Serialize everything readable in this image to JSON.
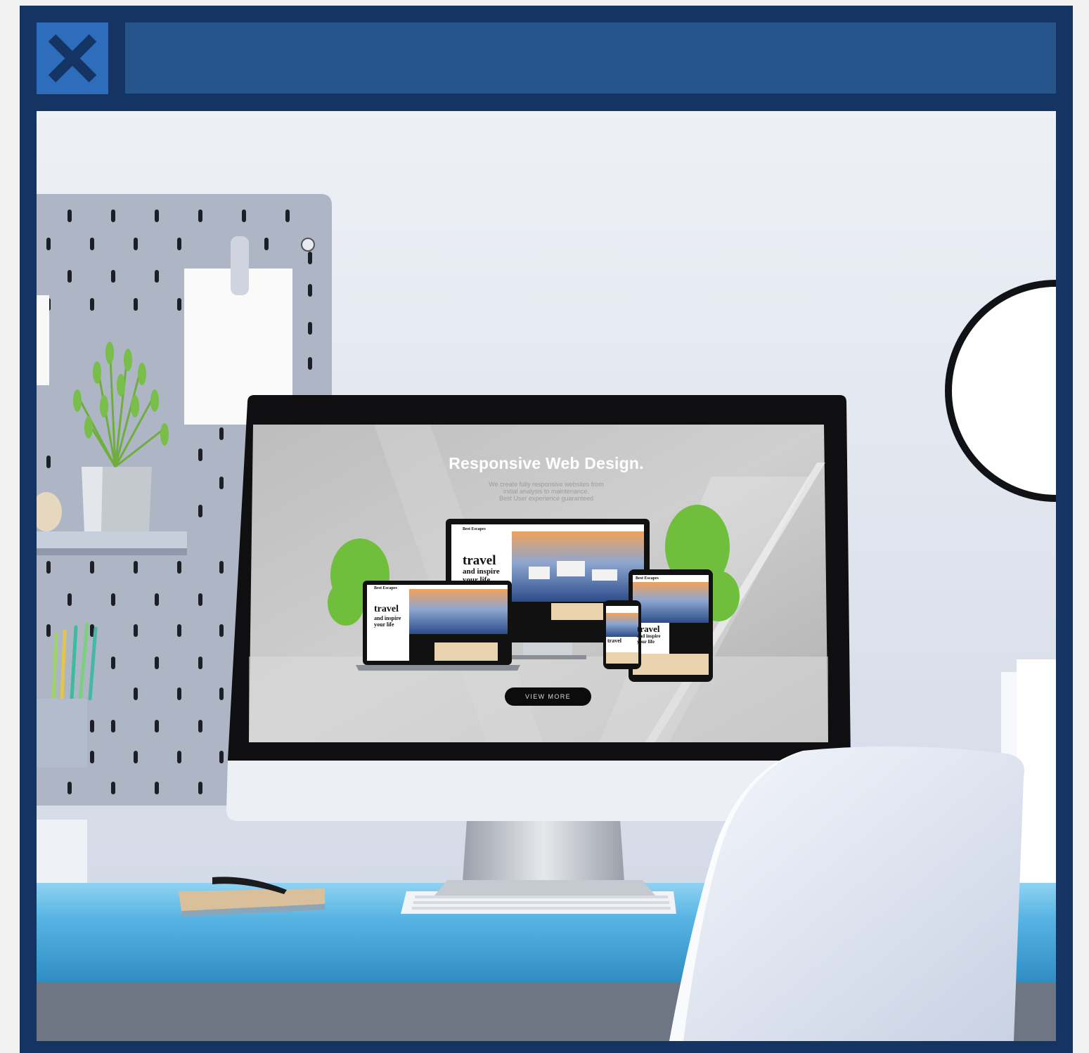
{
  "window": {
    "close_icon": "close-icon",
    "title": ""
  },
  "screen": {
    "heading": "Responsive Web Design.",
    "subtitle_lines": [
      "We create fully responsive websites from",
      "initial analysis to maintenance.",
      "Best User experience guaranteed"
    ],
    "button_label": "VIEW MORE"
  },
  "devices": {
    "brand": "Best Escapes",
    "headline": "travel",
    "tagline_1": "and inspire",
    "tagline_2": "your life"
  },
  "colors": {
    "frame": "#143563",
    "close_button": "#2d6dbc",
    "title_bar": "#26548b",
    "desk": "#58b4e3",
    "wall": "#e1e6f0"
  }
}
